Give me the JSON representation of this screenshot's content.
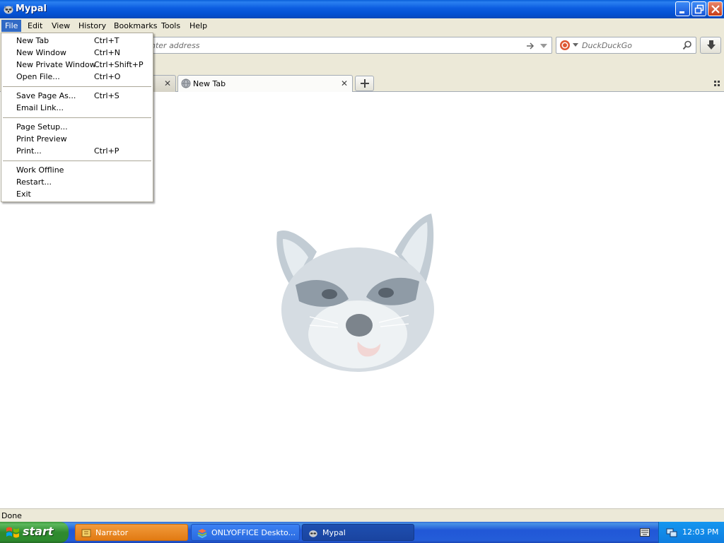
{
  "window": {
    "title": "Mypal"
  },
  "menubar": [
    {
      "label": "File",
      "active": true
    },
    {
      "label": "Edit"
    },
    {
      "label": "View"
    },
    {
      "label": "History"
    },
    {
      "label": "Bookmarks"
    },
    {
      "label": "Tools"
    },
    {
      "label": "Help"
    }
  ],
  "navbar": {
    "address_placeholder": "nter address",
    "search_placeholder": "DuckDuckGo"
  },
  "tabs": [
    {
      "label": "New Tab",
      "selected": true
    }
  ],
  "file_menu": {
    "groups": [
      [
        {
          "label": "New Tab",
          "shortcut": "Ctrl+T"
        },
        {
          "label": "New Window",
          "shortcut": "Ctrl+N"
        },
        {
          "label": "New Private Window",
          "shortcut": "Ctrl+Shift+P"
        },
        {
          "label": "Open File...",
          "shortcut": "Ctrl+O"
        }
      ],
      [
        {
          "label": "Save Page As...",
          "shortcut": "Ctrl+S"
        },
        {
          "label": "Email Link...",
          "shortcut": ""
        }
      ],
      [
        {
          "label": "Page Setup...",
          "shortcut": ""
        },
        {
          "label": "Print Preview",
          "shortcut": ""
        },
        {
          "label": "Print...",
          "shortcut": "Ctrl+P"
        }
      ],
      [
        {
          "label": "Work Offline",
          "shortcut": ""
        },
        {
          "label": "Restart...",
          "shortcut": ""
        },
        {
          "label": "Exit",
          "shortcut": ""
        }
      ]
    ]
  },
  "statusbar": {
    "text": "Done"
  },
  "taskbar": {
    "start_label": "start",
    "tasks": [
      {
        "label": "Narrator"
      },
      {
        "label": "ONLYOFFICE Deskto..."
      },
      {
        "label": "Mypal"
      }
    ],
    "clock": "12:03 PM"
  },
  "colors": {
    "titlebar": "#0b5ce0",
    "menu_highlight": "#316ac5",
    "start_green": "#3c9a3c",
    "narrator_task": "#e17a12"
  }
}
